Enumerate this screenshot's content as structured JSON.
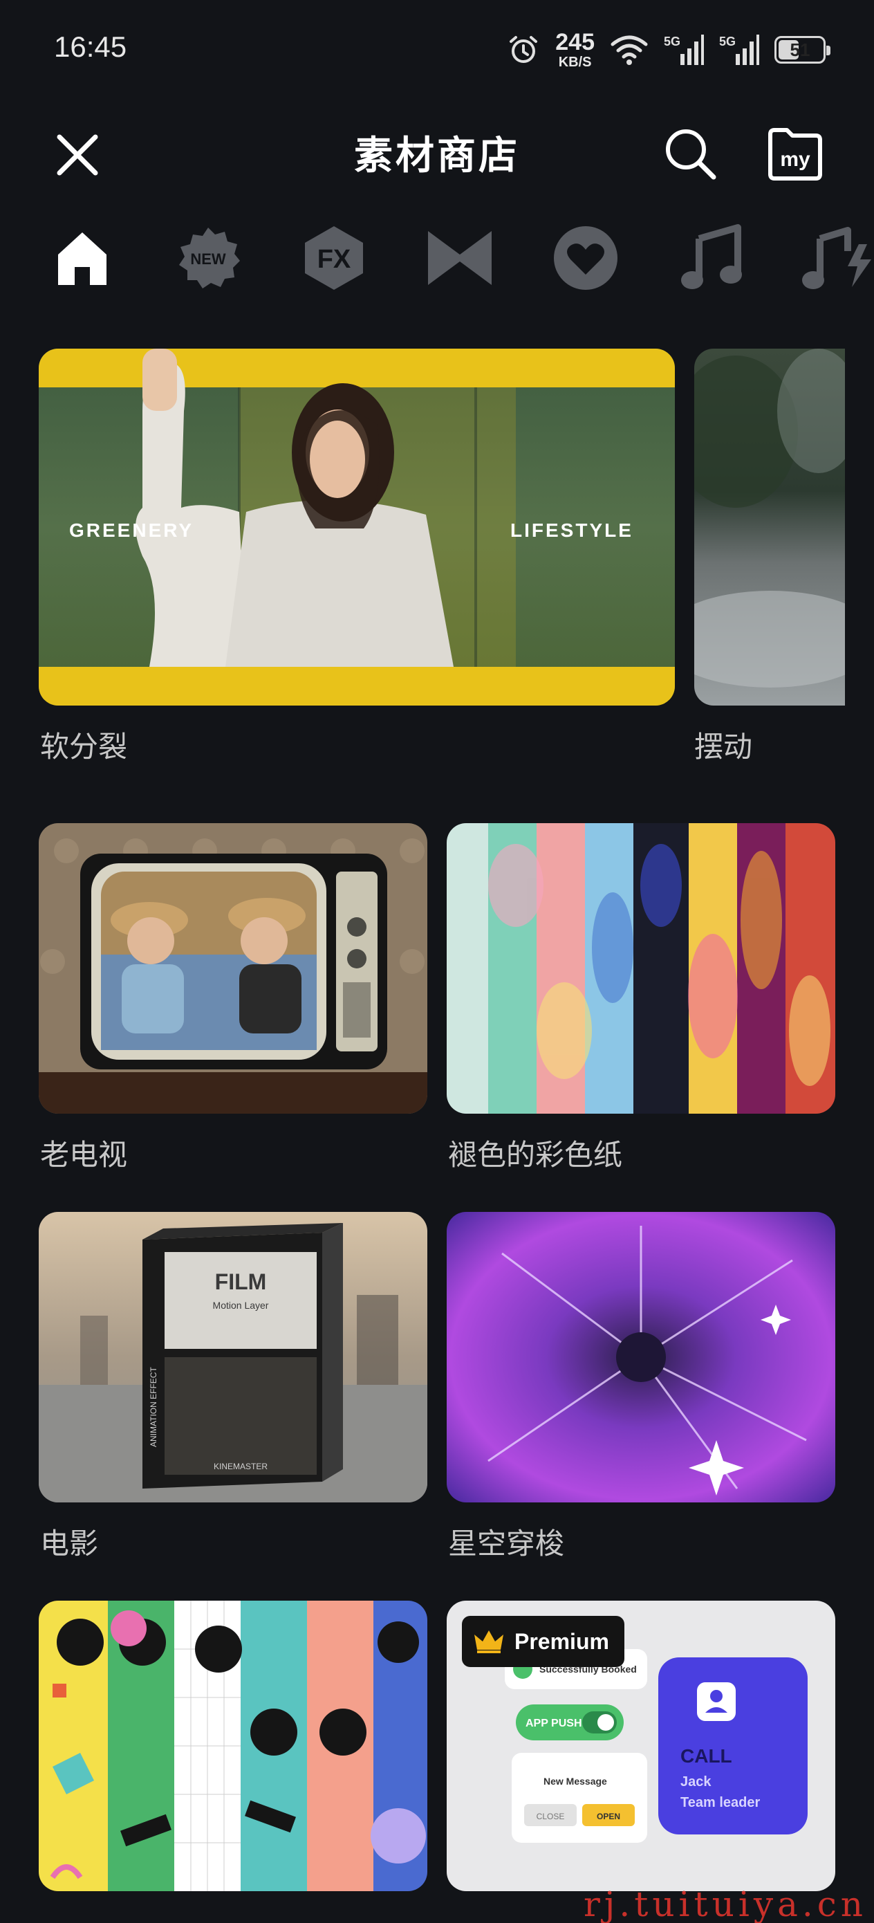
{
  "status_bar": {
    "time": "16:45",
    "net_speed_value": "245",
    "net_speed_unit": "KB/S",
    "battery": "51",
    "battery_level": 0.51,
    "signal_1": "5G",
    "signal_2": "5G"
  },
  "header": {
    "title": "素材商店",
    "my_label": "my"
  },
  "tabs": [
    {
      "icon": "home-icon",
      "active": true
    },
    {
      "icon": "new-badge-icon",
      "label": "NEW"
    },
    {
      "icon": "fx-icon",
      "label": "FX"
    },
    {
      "icon": "transition-icon"
    },
    {
      "icon": "heart-sticker-icon"
    },
    {
      "icon": "music-note-icon"
    },
    {
      "icon": "sound-effect-icon"
    }
  ],
  "featured": [
    {
      "label": "软分裂",
      "overlay_left": "GREENERY",
      "overlay_right": "LIFESTYLE"
    },
    {
      "label": "摆动"
    }
  ],
  "grid": [
    {
      "label": "老电视"
    },
    {
      "label": "褪色的彩色纸"
    },
    {
      "label": "电影",
      "box_title": "FILM",
      "box_sub": "Motion Layer",
      "box_side": "ANIMATION EFFECT",
      "box_brand": "KINEMASTER"
    },
    {
      "label": "星空穿梭"
    },
    {
      "label": ""
    },
    {
      "label": "",
      "premium": "Premium",
      "booked": "Successfully Booked",
      "app_push": "APP PUSH",
      "new_message": "New Message",
      "close": "CLOSE",
      "open": "OPEN",
      "call": "CALL",
      "caller_name": "Jack",
      "caller_role": "Team leader"
    }
  ],
  "watermark": "rj.tuituiya.cn",
  "colors": {
    "background": "#121418",
    "accent_yellow": "#e8c21a",
    "card_label": "#c8c8c8",
    "call_purple": "#4a3fe0"
  }
}
